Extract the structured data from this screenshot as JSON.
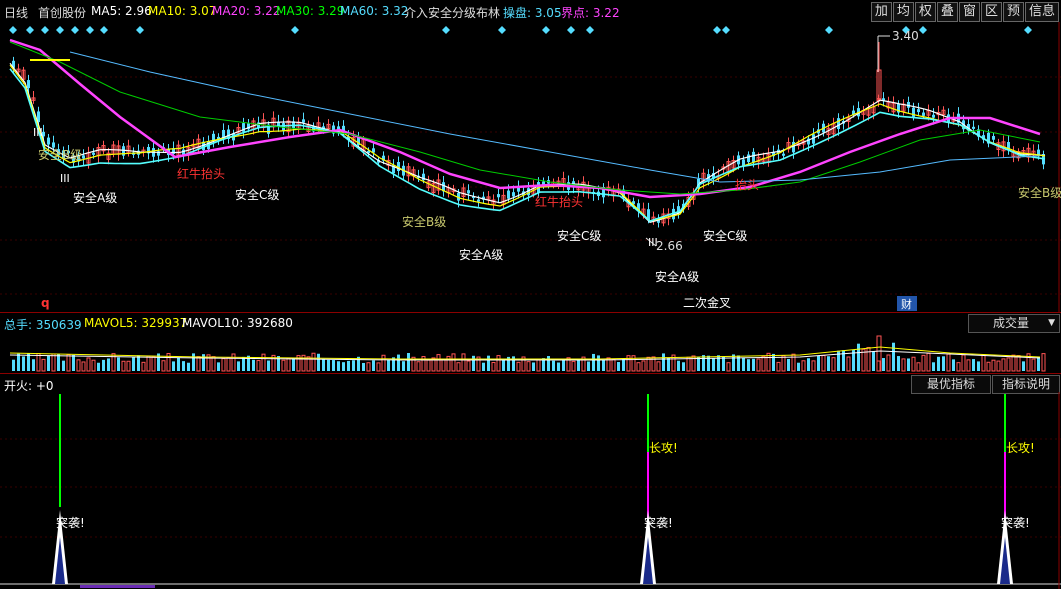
{
  "header": {
    "period": "日线",
    "stock_name": "首创股份",
    "ma": [
      {
        "label": "MA5: 2.96",
        "color": "#ffffff"
      },
      {
        "label": "MA10: 3.07",
        "color": "#ffff00"
      },
      {
        "label": "MA20: 3.22",
        "color": "#ff44ff"
      },
      {
        "label": "MA30: 3.29",
        "color": "#00ff00"
      },
      {
        "label": "MA60: 3.32",
        "color": "#55ddff"
      }
    ],
    "indicator_name": "介入安全分级布林",
    "caopan": "操盘: 3.05",
    "jiedian": "界点: 3.22",
    "caopan_color": "#55ddff",
    "jiedian_color": "#ff44ff"
  },
  "toolbar": {
    "buttons": [
      "加",
      "均",
      "权",
      "叠",
      "窗",
      "区",
      "预",
      "信息"
    ]
  },
  "main_chart": {
    "high_label": "3.40",
    "low_label": "2.66",
    "annotations": [
      {
        "text": "安全B级",
        "color": "#c8c86e"
      },
      {
        "text": "安全A级",
        "color": "#ffffff"
      },
      {
        "text": "红牛抬头",
        "color": "#ff3333"
      },
      {
        "text": "安全C级",
        "color": "#ffffff"
      },
      {
        "text": "安全B级",
        "color": "#c8c86e"
      },
      {
        "text": "安全A级",
        "color": "#ffffff"
      },
      {
        "text": "红牛抬头",
        "color": "#ff3333"
      },
      {
        "text": "安全C级",
        "color": "#ffffff"
      },
      {
        "text": "安全C级",
        "color": "#ffffff"
      },
      {
        "text": "安全A级",
        "color": "#ffffff"
      },
      {
        "text": "二次金叉",
        "color": "#ffffff"
      },
      {
        "text": "抬头",
        "color": "#ff3333"
      },
      {
        "text": "安全B级",
        "color": "#c8c86e"
      }
    ],
    "roman_marks": [
      "III",
      "III",
      "III"
    ],
    "bottom_marks": {
      "q": "q",
      "cai": "财"
    }
  },
  "volume": {
    "total": "总手: 350639",
    "mavol5": "MAVOL5: 329937",
    "mavol10": "MAVOL10: 392680",
    "selector": "成交量",
    "total_color": "#55ddff",
    "mavol5_color": "#ffff00",
    "mavol10_color": "#ffffff"
  },
  "indicator": {
    "label": "开火: +0",
    "best_button": "最优指标",
    "explain_button": "指标说明",
    "signals": [
      {
        "long": "",
        "tu": "突袭!"
      },
      {
        "long": "长攻!",
        "tu": "突袭!"
      },
      {
        "long": "长攻!",
        "tu": "突袭!"
      }
    ]
  }
}
